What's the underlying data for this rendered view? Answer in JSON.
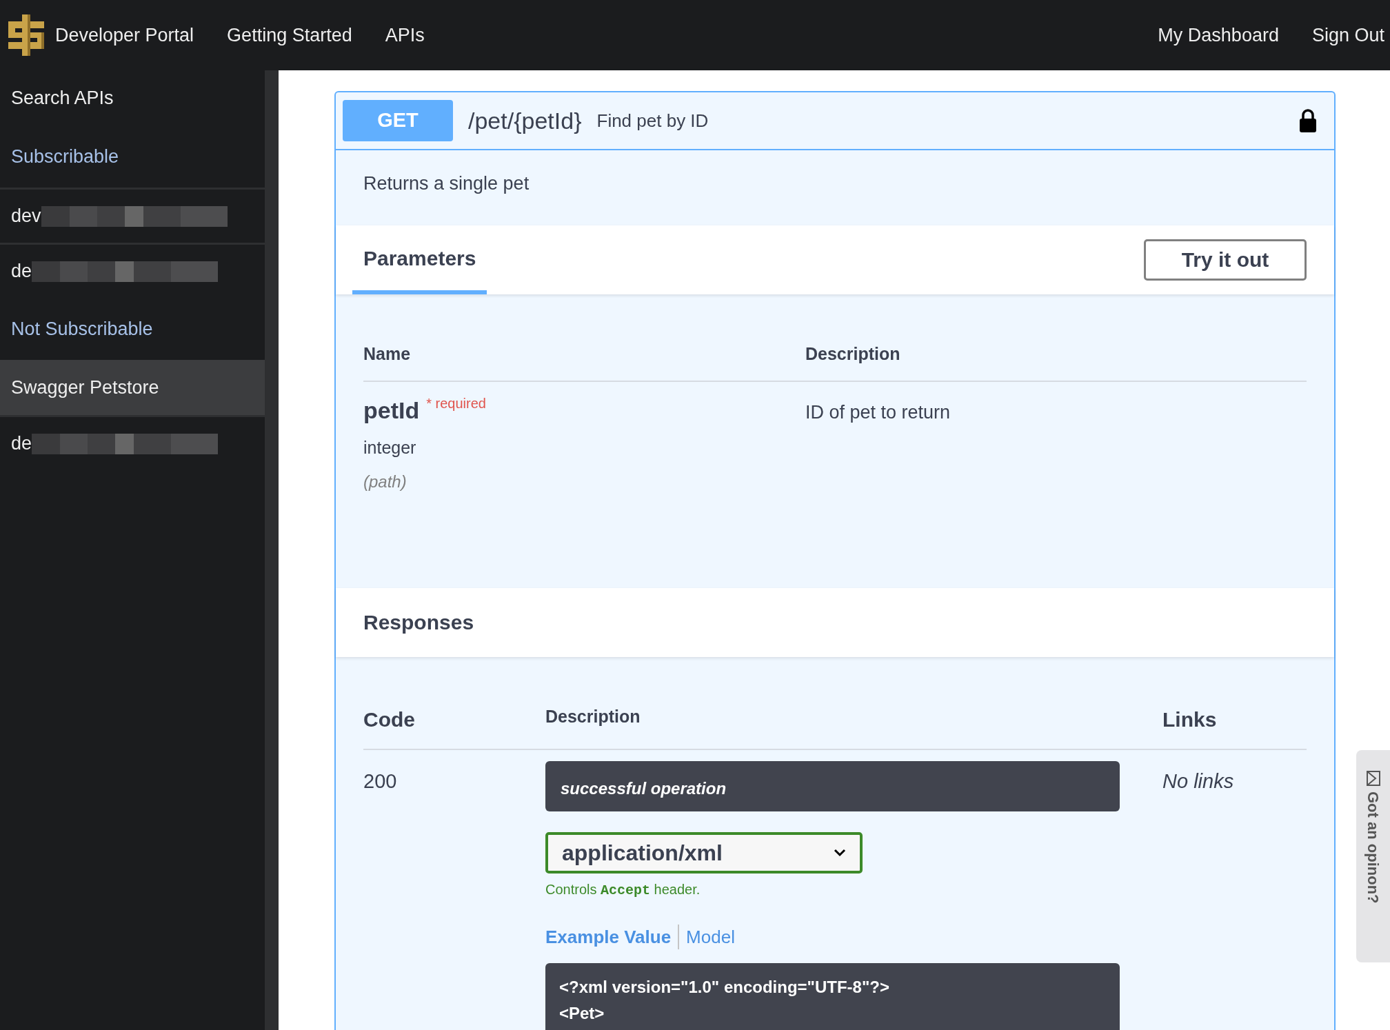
{
  "navbar": {
    "brand": "Developer Portal",
    "links": [
      "Getting Started",
      "APIs"
    ],
    "right_links": [
      "My Dashboard",
      "Sign Out"
    ]
  },
  "sidebar": {
    "items": [
      {
        "label": "Search APIs",
        "kind": "link",
        "selected": false
      },
      {
        "label": "Subscribable",
        "kind": "heading",
        "selected": false
      },
      {
        "label": "dev",
        "kind": "redacted",
        "selected": false
      },
      {
        "label": "de",
        "kind": "redacted",
        "selected": false
      },
      {
        "label": "Not Subscribable",
        "kind": "heading",
        "selected": false
      },
      {
        "label": "Swagger Petstore",
        "kind": "link",
        "selected": true
      },
      {
        "label": "de",
        "kind": "redacted",
        "selected": false
      }
    ]
  },
  "operation": {
    "method": "GET",
    "path": "/pet/{petId}",
    "summary": "Find pet by ID",
    "locked": true,
    "description": "Returns a single pet",
    "tabs": [
      {
        "label": "Parameters",
        "selected": true
      }
    ],
    "try_button": "Try it out",
    "parameters": {
      "columns": [
        "Name",
        "Description"
      ],
      "rows": [
        {
          "name": "petId",
          "required": true,
          "required_label": "* required",
          "type": "integer",
          "location": "(path)",
          "description": "ID of pet to return"
        }
      ]
    },
    "responses": {
      "title": "Responses",
      "columns": [
        "Code",
        "Description",
        "Links"
      ],
      "rows": [
        {
          "code": "200",
          "description": "successful operation",
          "media_type": "application/xml",
          "media_hint": [
            "Controls",
            "Accept",
            "header."
          ],
          "example_tabs": [
            {
              "label": "Example Value",
              "selected": true
            },
            {
              "label": "Model",
              "selected": false
            }
          ],
          "example_lines": [
            "<?xml version=\"1.0\" encoding=\"UTF-8\"?>",
            "<Pet>"
          ],
          "links": "No links"
        }
      ]
    }
  },
  "feedback": {
    "label": "Got an opinon?"
  }
}
